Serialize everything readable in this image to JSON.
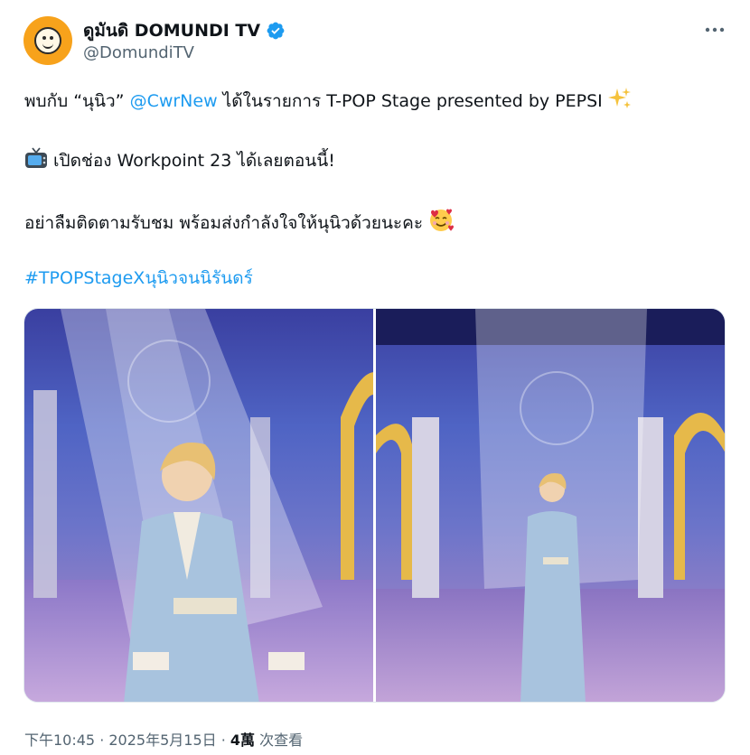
{
  "author": {
    "display_name": "ดูมันดิ DOMUNDI TV",
    "handle": "@DomundiTV",
    "verified": true,
    "avatar_icon": "domundi-logo",
    "more_icon": "more-horizontal-icon"
  },
  "tweet": {
    "line1_pre": "พบกับ “นุนิว” ",
    "line1_mention": "@CwrNew",
    "line1_post": " ได้ในรายการ T-POP Stage presented by PEPSI",
    "line1_emoji": "sparkles",
    "line2_emoji": "tv",
    "line2_text": " เปิดช่อง Workpoint 23 ได้เลยตอนนี้!",
    "line3_text": "อย่าลืมติดตามรับชม พร้อมส่งกำลังใจให้นุนิวด้วยนะคะ ",
    "line3_emoji": "smiling-face-with-hearts",
    "hashtag": "#TPOPStageXนุนิวจนนิรันดร์"
  },
  "media": {
    "count": 2,
    "photos": [
      "photo-1",
      "photo-2"
    ]
  },
  "meta": {
    "time": "下午10:45 · 2025年5月15日 · ",
    "views_count": "4萬",
    "views_label": " 次查看"
  },
  "colors": {
    "accent": "#1d9bf0",
    "text": "#0f1419",
    "secondary": "#536471",
    "avatar_bg": "#f7a21b"
  }
}
